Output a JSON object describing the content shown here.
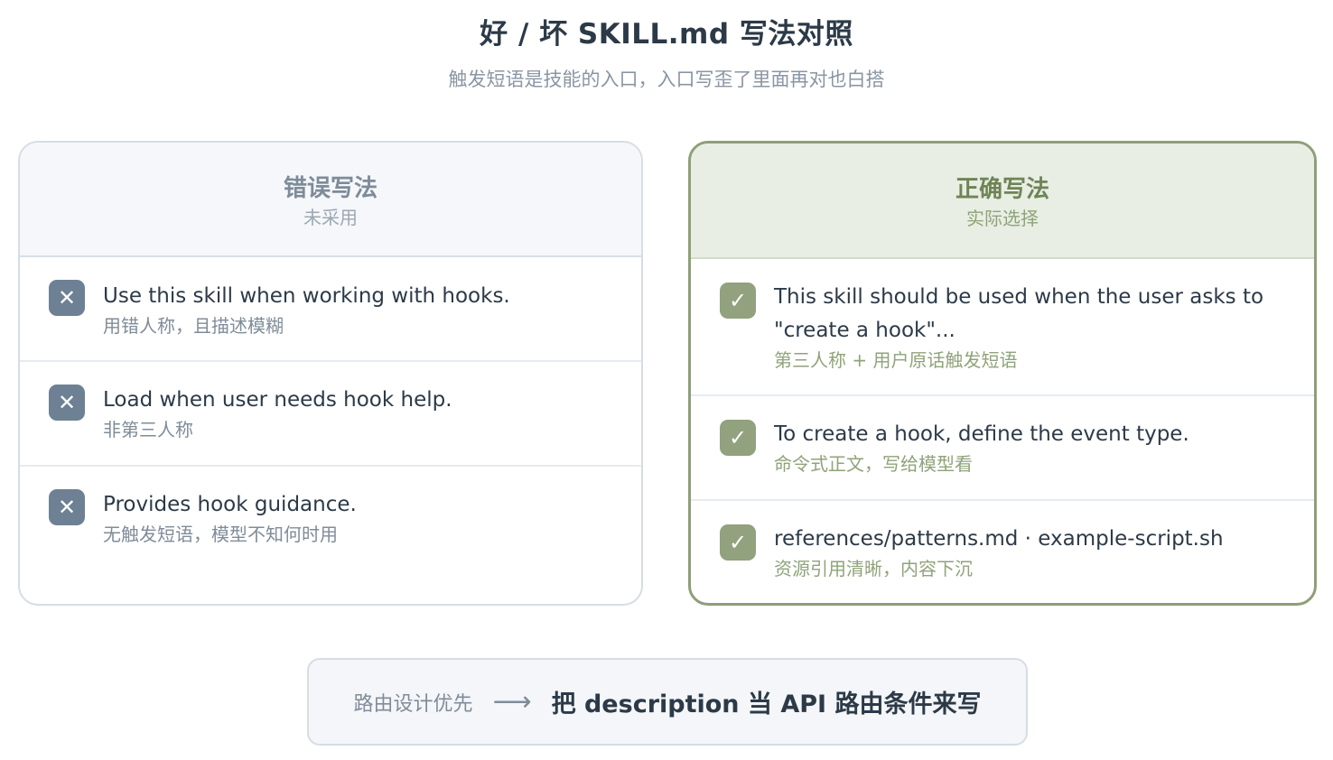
{
  "header": {
    "title": "好 / 坏 SKILL.md 写法对照",
    "subtitle": "触发短语是技能的入口，入口写歪了里面再对也白搭"
  },
  "bad_card": {
    "title": "错误写法",
    "subtitle": "未采用",
    "icon": "cross-icon",
    "items": [
      {
        "text": "Use this skill when working with hooks.",
        "note": "用错人称，且描述模糊"
      },
      {
        "text": "Load when user needs hook help.",
        "note": "非第三人称"
      },
      {
        "text": "Provides hook guidance.",
        "note": "无触发短语，模型不知何时用"
      }
    ]
  },
  "good_card": {
    "title": "正确写法",
    "subtitle": "实际选择",
    "icon": "check-icon",
    "items": [
      {
        "text": "This skill should be used when the user asks to \"create a hook\"...",
        "note": "第三人称 + 用户原话触发短语"
      },
      {
        "text": "To create a hook, define the event type.",
        "note": "命令式正文，写给模型看"
      },
      {
        "text": "references/patterns.md · example-script.sh",
        "note": "资源引用清晰，内容下沉"
      }
    ]
  },
  "banner": {
    "left": "路由设计优先",
    "arrow": "⟶",
    "right": "把 description 当 API 路由条件来写"
  },
  "colors": {
    "bad_accent": "#6e8093",
    "good_accent": "#92a17e",
    "good_border": "#8e9f78"
  }
}
